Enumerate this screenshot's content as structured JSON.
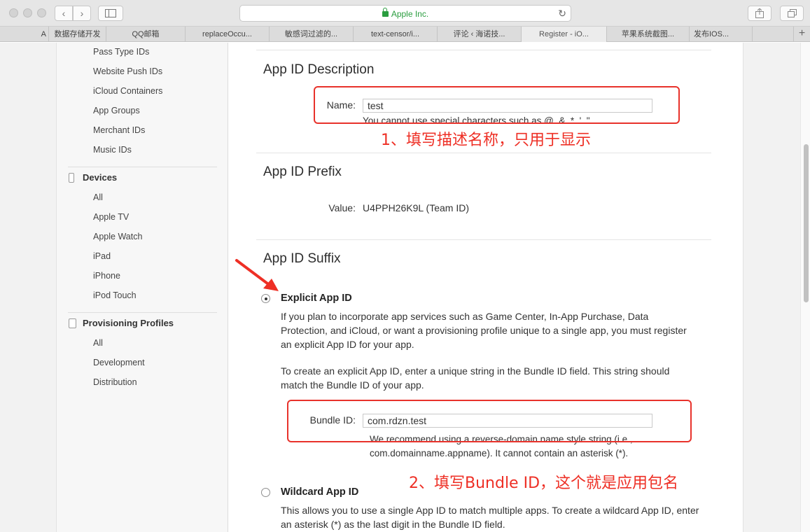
{
  "browser": {
    "url": "Apple Inc.",
    "tabs": [
      "A",
      "数据存储开发",
      "QQ邮箱",
      "replaceOccu...",
      "敏感词过滤的...",
      "text-censor/i...",
      "评论 ‹ 海诺技...",
      "Register - iO...",
      "苹果系统截图...",
      "发布IOS..."
    ],
    "active_tab": "Register - iO...",
    "new_tab": "+"
  },
  "sidebar": {
    "identifiers_items": [
      "Pass Type IDs",
      "Website Push IDs",
      "iCloud Containers",
      "App Groups",
      "Merchant IDs",
      "Music IDs"
    ],
    "devices_title": "Devices",
    "devices_items": [
      "All",
      "Apple TV",
      "Apple Watch",
      "iPad",
      "iPhone",
      "iPod Touch"
    ],
    "profiles_title": "Provisioning Profiles",
    "profiles_items": [
      "All",
      "Development",
      "Distribution"
    ]
  },
  "main": {
    "description": {
      "title": "App ID Description",
      "name_label": "Name:",
      "name_value": "test",
      "name_hint": "You cannot use special characters such as @, &, *, ', \""
    },
    "prefix": {
      "title": "App ID Prefix",
      "value_label": "Value:",
      "value": "U4PPH26K9L (Team ID)"
    },
    "suffix": {
      "title": "App ID Suffix",
      "explicit_title": "Explicit App ID",
      "explicit_para1": "If you plan to incorporate app services such as Game Center, In-App Purchase, Data Protection, and iCloud, or want a provisioning profile unique to a single app, you must register an explicit App ID for your app.",
      "explicit_para2": "To create an explicit App ID, enter a unique string in the Bundle ID field. This string should match the Bundle ID of your app.",
      "bundle_label": "Bundle ID:",
      "bundle_value": "com.rdzn.test",
      "bundle_hint": "We recommend using a reverse-domain name style string (i.e., com.domainname.appname). It cannot contain an asterisk (*).",
      "wildcard_title": "Wildcard App ID",
      "wildcard_para": "This allows you to use a single App ID to match multiple apps. To create a wildcard App ID, enter an asterisk (*) as the last digit in the Bundle ID field."
    }
  },
  "annotations": {
    "note1": "1、填写描述名称，只用于显示",
    "note2": "2、填写Bundle ID，这个就是应用包名",
    "color": "#ee2f25"
  }
}
